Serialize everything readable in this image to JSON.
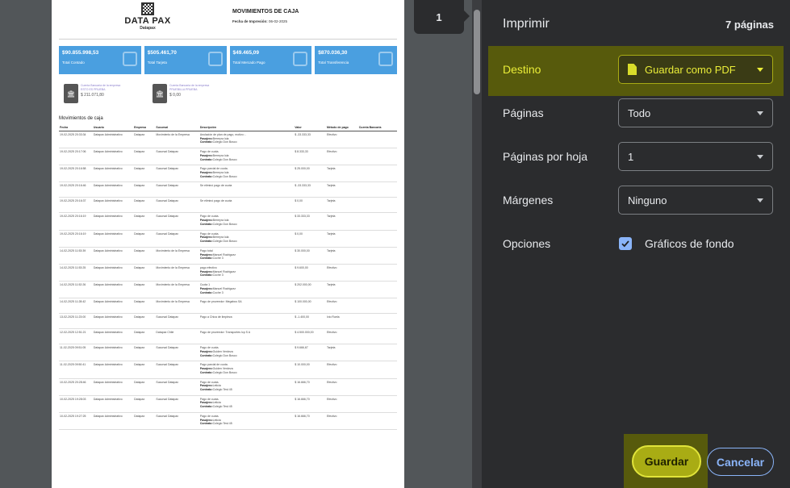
{
  "preview": {
    "page_number": "1",
    "document": {
      "logo_text": "DATA PAX",
      "logo_sub": "Datapax",
      "title": "MOVIMIENTOS DE CAJA",
      "date_label": "Fecha de Impresión:",
      "date_value": "06-02-2025",
      "cards": [
        {
          "amount": "$90.855.998,53",
          "label": "Total Contado",
          "icon": "money-hand-icon"
        },
        {
          "amount": "$505.461,70",
          "label": "Total Tarjeta",
          "icon": "credit-card-icon"
        },
        {
          "amount": "$49.465,09",
          "label": "Total Mercado Pago",
          "icon": "qr-code-icon"
        },
        {
          "amount": "$870.036,30",
          "label": "Total Transferencia",
          "icon": "bank-icon"
        }
      ],
      "banks": [
        {
          "line1": "Cuenta Bancaria de la empresa",
          "line2": "ESTO ES PRUEBA",
          "amount": "$ 211.071,80"
        },
        {
          "line1": "Cuenta Bancaria de la empresa",
          "line2": "PRUEBILLA PRUEBA",
          "amount": "$ 0,00"
        }
      ],
      "section_title": "Movimientos de caja",
      "columns": [
        "Fecha",
        "Usuario",
        "Empresa",
        "Sucursal",
        "Descripción",
        "Valor",
        "Método de pago",
        "Cuenta Bancaria"
      ],
      "rows": [
        {
          "fecha": "19-02-2025 20:33:34",
          "usuario": "Datapax Administrativo",
          "empresa": "Datapax",
          "sucursal": "Movimiento de la Empresa",
          "green": true,
          "desc": [
            "Anulación de plan de pago, motivo: -"
          ],
          "pasajero": "Berreyra lola",
          "contrato": "Colegio Don Bosco",
          "valor": "$ -33.333,33",
          "metodo": "Efectivo"
        },
        {
          "fecha": "19-02-2025 20:17:06",
          "usuario": "Datapax Administrativo",
          "empresa": "Datapax",
          "sucursal": "Sucursal Datapax",
          "green": false,
          "desc": [
            "Pago de cuota."
          ],
          "pasajero": "Berreyra lola",
          "contrato": "Colegio Don Bosco",
          "valor": "$ 8.333,33",
          "metodo": "Efectivo"
        },
        {
          "fecha": "19-02-2025 20:16:58",
          "usuario": "Datapax Administrativo",
          "empresa": "Datapax",
          "sucursal": "Sucursal Datapax",
          "green": false,
          "desc": [
            "Pago parcial de cuota."
          ],
          "pasajero": "Berreyra lola",
          "contrato": "Colegio Don Bosco",
          "valor": "$ 25.000,00",
          "metodo": "Tarjeta"
        },
        {
          "fecha": "19-02-2025 20:16:46",
          "usuario": "Datapax Administrativo",
          "empresa": "Datapax",
          "sucursal": "Sucursal Datapax",
          "green": false,
          "desc": [
            "Se eliminó pago de cuota"
          ],
          "pasajero": "",
          "contrato": "",
          "valor": "$ -33.333,33",
          "metodo": "Tarjeta"
        },
        {
          "fecha": "19-02-2025 20:16:37",
          "usuario": "Datapax Administrativo",
          "empresa": "Datapax",
          "sucursal": "Sucursal Datapax",
          "green": false,
          "desc": [
            "Se eliminó pago de cuota"
          ],
          "pasajero": "",
          "contrato": "",
          "valor": "$ 0,00",
          "metodo": "Tarjeta"
        },
        {
          "fecha": "19-02-2025 20:16:19",
          "usuario": "Datapax Administrativo",
          "empresa": "Datapax",
          "sucursal": "Sucursal Datapax",
          "green": false,
          "desc": [
            "Pago de cuota."
          ],
          "pasajero": "Berreyra lola",
          "contrato": "Colegio Don Bosco",
          "valor": "$ 33.333,33",
          "metodo": "Tarjeta"
        },
        {
          "fecha": "19-02-2025 20:16:19",
          "usuario": "Datapax Administrativo",
          "empresa": "Datapax",
          "sucursal": "Sucursal Datapax",
          "green": false,
          "desc": [
            "Pago de cuota."
          ],
          "pasajero": "Berreyra lola",
          "contrato": "Colegio Don Bosco",
          "valor": "$ 0,00",
          "metodo": "Tarjeta"
        },
        {
          "fecha": "14-02-2025 11:53:39",
          "usuario": "Datapax Administrativo",
          "empresa": "Datapax",
          "sucursal": "Movimiento de la Empresa",
          "green": true,
          "desc": [
            "Pago total"
          ],
          "pasajero": "Manuel Rodriguez",
          "contrato": "Coche 3",
          "valor": "$ 30.000,00",
          "metodo": "Tarjeta"
        },
        {
          "fecha": "14-02-2025 11:53:25",
          "usuario": "Datapax Administrativo",
          "empresa": "Datapax",
          "sucursal": "Movimiento de la Empresa",
          "green": true,
          "desc": [
            "pago efectivo"
          ],
          "pasajero": "Manuel Rodriguez",
          "contrato": "Coche 3",
          "valor": "$ 9.600,00",
          "metodo": "Efectivo"
        },
        {
          "fecha": "14-02-2025 11:52:26",
          "usuario": "Datapax Administrativo",
          "empresa": "Datapax",
          "sucursal": "Movimiento de la Empresa",
          "green": true,
          "desc": [
            "Cuota 1"
          ],
          "pasajero": "Manuel Rodriguez",
          "contrato": "Coche 3",
          "valor": "$ 202.000,00",
          "metodo": "Tarjeta"
        },
        {
          "fecha": "14-02-2025 11:28:42",
          "usuario": "Datapax Administrativo",
          "empresa": "Datapax",
          "sucursal": "Movimiento de la Empresa",
          "green": true,
          "desc": [
            "Pago de proveedor: Megabus SA"
          ],
          "pasajero": "",
          "contrato": "",
          "valor": "$ 100.000,00",
          "metodo": "Efectivo"
        },
        {
          "fecha": "13-02-2025 11:23:00",
          "usuario": "Datapax Administrativo",
          "empresa": "Datapax",
          "sucursal": "Sucursal Datapax",
          "green": false,
          "desc": [
            "Pago a Chica de limpieza"
          ],
          "pasajero": "",
          "contrato": "",
          "valor": "$ -1.400,00",
          "metodo": "Ivio Ruela"
        },
        {
          "fecha": "12-02-2025 12:51:21",
          "usuario": "Datapax Administrativo",
          "empresa": "Datapax",
          "sucursal": "Datapax Chile",
          "green": false,
          "desc": [
            "Pago de proveedor: Transportes Icp S A"
          ],
          "pasajero": "",
          "contrato": "",
          "valor": "$ 4.500.000,00",
          "metodo": "Efectivo"
        },
        {
          "fecha": "11-02-2025 09:51:05",
          "usuario": "Datapax Administrativo",
          "empresa": "Datapax",
          "sucursal": "Sucursal Datapax",
          "green": false,
          "desc": [
            "Pago de cuota."
          ],
          "pasajero": "Guiden Verdeza",
          "contrato": "Colegio Don Bosco",
          "valor": "$ 9.666,67",
          "metodo": "Tarjeta"
        },
        {
          "fecha": "11-02-2025 09:50:41",
          "usuario": "Datapax Administrativo",
          "empresa": "Datapax",
          "sucursal": "Sucursal Datapax",
          "green": false,
          "desc": [
            "Pago parcial de cuota."
          ],
          "pasajero": "Guiden Verdeza",
          "contrato": "Colegio Don Bosco",
          "valor": "$ 10.000,00",
          "metodo": "Efectivo"
        },
        {
          "fecha": "10-02-2025 20:28:46",
          "usuario": "Datapax Administrativo",
          "empresa": "Datapax",
          "sucursal": "Sucursal Datapax",
          "green": false,
          "desc": [
            "Pago de cuota."
          ],
          "pasajero": "Leticia",
          "contrato": "Colegio Test 45",
          "valor": "$ 16.666,70",
          "metodo": "Efectivo"
        },
        {
          "fecha": "10-02-2025 19:28:03",
          "usuario": "Datapax Administrativo",
          "empresa": "Datapax",
          "sucursal": "Sucursal Datapax",
          "green": false,
          "desc": [
            "Pago de cuota."
          ],
          "pasajero": "Leticia",
          "contrato": "Colegio Test 45",
          "valor": "$ 16.666,70",
          "metodo": "Efectivo"
        },
        {
          "fecha": "10-02-2025 19:27:25",
          "usuario": "Datapax Administrativo",
          "empresa": "Datapax",
          "sucursal": "Sucursal Datapax",
          "green": false,
          "desc": [
            "Pago de cuota."
          ],
          "pasajero": "Leticia",
          "contrato": "Colegio Test 45",
          "valor": "$ 16.666,70",
          "metodo": "Efectivo"
        }
      ],
      "pasajero_label": "Pasajero:",
      "contrato_label": "Contrato:"
    }
  },
  "panel": {
    "title": "Imprimir",
    "page_count": "7 páginas",
    "destination": {
      "label": "Destino",
      "value": "Guardar como PDF"
    },
    "pages": {
      "label": "Páginas",
      "value": "Todo"
    },
    "per_sheet": {
      "label": "Páginas por hoja",
      "value": "1"
    },
    "margins": {
      "label": "Márgenes",
      "value": "Ninguno"
    },
    "options": {
      "label": "Opciones",
      "checkbox_label": "Gráficos de fondo",
      "checked": true
    },
    "save_label": "Guardar",
    "cancel_label": "Cancelar",
    "colors": {
      "highlight": "#575a0c",
      "accent_yellow": "#eaed38",
      "accent_blue": "#8ab4f8",
      "card_blue": "#4a9fe0"
    }
  }
}
